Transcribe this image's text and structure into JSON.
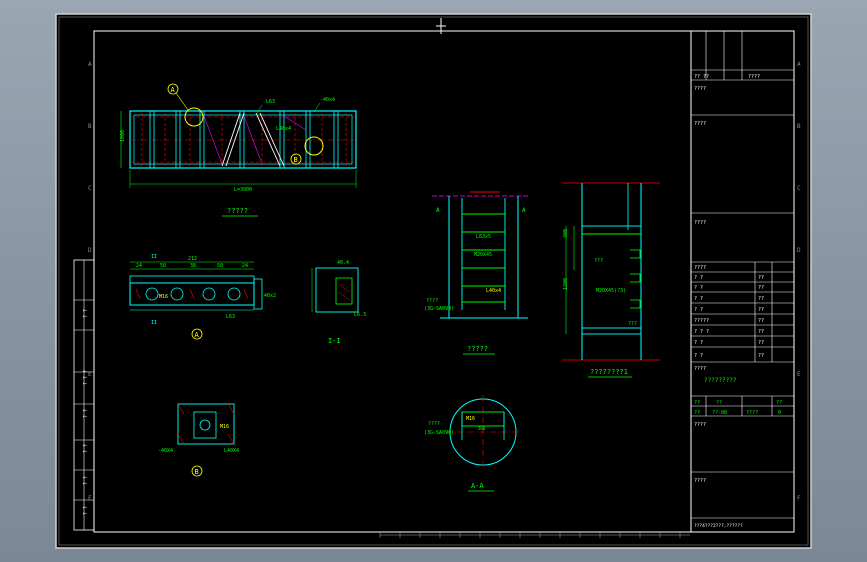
{
  "colors": {
    "background": "#000000",
    "frame": "#ffffff",
    "steel": "#00ffff",
    "dimension": "#00ff00",
    "hatch": "#ff0000",
    "label": "#ffff00",
    "accent": "#ff00ff"
  },
  "views": {
    "elevation_title": "?????",
    "elevation_overall_dim": "L=3000",
    "elevation_height_dim": "1000",
    "elevation_note_a": "L63",
    "elevation_note_b": "-40x4",
    "elevation_note_c": "L40x4",
    "callout_a": "A",
    "callout_b": "B",
    "detail_a_title": "A",
    "detail_a_dims": [
      "24",
      "50",
      "38",
      "50",
      "24"
    ],
    "detail_a_total": "212",
    "detail_a_bolt": "M16",
    "detail_a_angle": "L63",
    "detail_a_right": "40x2",
    "detail_a_section_mark": "II",
    "section_11_title": "I-I",
    "section_11_dim": "40.4",
    "section_11_angle": "L6.3",
    "detail_b_title": "B",
    "detail_b_bolt": "M16",
    "detail_b_left": "-40X4",
    "detail_b_right": "L40X4",
    "ladder_title": "?????",
    "ladder_note1": "L63x5",
    "ladder_note2": "M20X45",
    "ladder_note3": "L40x4",
    "ladder_note4": "????",
    "ladder_note5": "(3G-SA090)",
    "ladder_section_mark": "A",
    "side_title": "????????1",
    "side_dim1": "300",
    "side_dim2": "1200",
    "side_label1": "???",
    "side_label2": "M20X45(?3)",
    "side_label3": "???",
    "aa_title": "A-A",
    "aa_note1": "????",
    "aa_note2": "(3G-SA090)",
    "aa_bolt": "M16",
    "aa_dim": "300"
  },
  "title_block": {
    "row_designer": [
      "?? ??",
      "????"
    ],
    "label_project": "????",
    "label_sub": "????",
    "label_content": "????",
    "table_header": "????",
    "table_rows": [
      [
        "? ?",
        "??"
      ],
      [
        "? ?",
        "??"
      ],
      [
        "? ?",
        "??"
      ],
      [
        "? ?",
        "??"
      ],
      [
        "?????",
        "??"
      ],
      [
        "? ? ?",
        "??"
      ],
      [
        "? ?",
        "??"
      ],
      [
        "? ?",
        "??"
      ]
    ],
    "drawing_title": "????",
    "drawing_name": "?????????",
    "code_row1": [
      "??",
      "??",
      "??"
    ],
    "code_row2": [
      "??",
      "??-08",
      "????",
      "0"
    ],
    "remark": "????",
    "bottom_label": "????",
    "footer": "???4???2???,??????"
  },
  "left_strip": {
    "cells": [
      "? ?",
      "? ? ?",
      "? ?",
      "? ?",
      "? ?",
      "? ?"
    ]
  },
  "frame_marks": {
    "letters": [
      "A",
      "B",
      "C",
      "D",
      "E",
      "F"
    ],
    "numbers": [
      "1",
      "2",
      "3",
      "4",
      "5",
      "6",
      "7",
      "8"
    ]
  }
}
